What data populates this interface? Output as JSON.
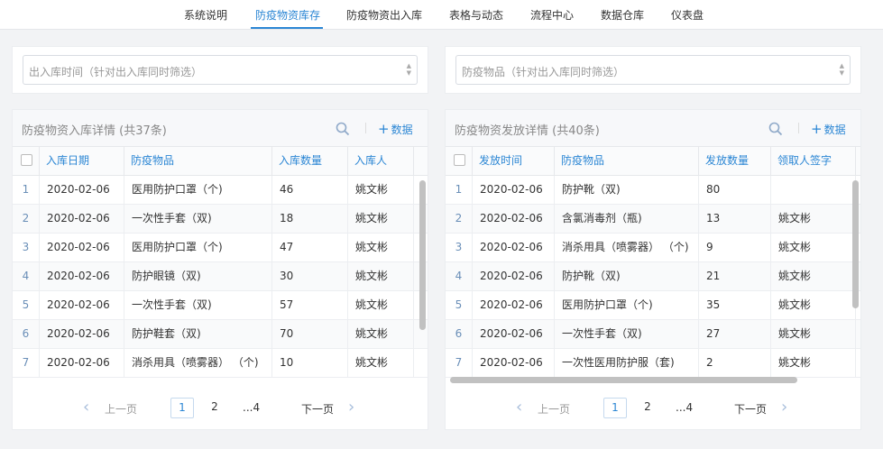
{
  "nav": {
    "items": [
      "系统说明",
      "防疫物资库存",
      "防疫物资出入库",
      "表格与动态",
      "流程中心",
      "数据仓库",
      "仪表盘"
    ],
    "active_index": 1
  },
  "filters": {
    "left_placeholder": "出入库时间（针对出入库同时筛选）",
    "right_placeholder": "防疫物品（针对出入库同时筛选）"
  },
  "left_panel": {
    "title": "防疫物资入库详情 (共37条)",
    "add_label": "数据",
    "columns": [
      "入库日期",
      "防疫物品",
      "入库数量",
      "入库人"
    ],
    "rows": [
      {
        "no": "1",
        "date": "2020-02-06",
        "item": "医用防护口罩（个)",
        "qty": "46",
        "person": "姚文彬"
      },
      {
        "no": "2",
        "date": "2020-02-06",
        "item": "一次性手套（双)",
        "qty": "18",
        "person": "姚文彬"
      },
      {
        "no": "3",
        "date": "2020-02-06",
        "item": "医用防护口罩（个)",
        "qty": "47",
        "person": "姚文彬"
      },
      {
        "no": "4",
        "date": "2020-02-06",
        "item": "防护眼镜（双)",
        "qty": "30",
        "person": "姚文彬"
      },
      {
        "no": "5",
        "date": "2020-02-06",
        "item": "一次性手套（双)",
        "qty": "57",
        "person": "姚文彬"
      },
      {
        "no": "6",
        "date": "2020-02-06",
        "item": "防护鞋套（双)",
        "qty": "70",
        "person": "姚文彬"
      },
      {
        "no": "7",
        "date": "2020-02-06",
        "item": "消杀用具（喷雾器） （个)",
        "qty": "10",
        "person": "姚文彬"
      }
    ],
    "pager": {
      "prev": "上一页",
      "next": "下一页",
      "pages": [
        "1",
        "2"
      ],
      "last": "...4"
    }
  },
  "right_panel": {
    "title": "防疫物资发放详情 (共40条)",
    "add_label": "数据",
    "columns": [
      "发放时间",
      "防疫物品",
      "发放数量",
      "领取人签字"
    ],
    "rows": [
      {
        "no": "1",
        "date": "2020-02-06",
        "item": "防护靴（双)",
        "qty": "80",
        "person": ""
      },
      {
        "no": "2",
        "date": "2020-02-06",
        "item": "含氯消毒剂（瓶)",
        "qty": "13",
        "person": "姚文彬"
      },
      {
        "no": "3",
        "date": "2020-02-06",
        "item": "消杀用具（喷雾器） （个)",
        "qty": "9",
        "person": "姚文彬"
      },
      {
        "no": "4",
        "date": "2020-02-06",
        "item": "防护靴（双)",
        "qty": "21",
        "person": "姚文彬"
      },
      {
        "no": "5",
        "date": "2020-02-06",
        "item": "医用防护口罩（个)",
        "qty": "35",
        "person": "姚文彬"
      },
      {
        "no": "6",
        "date": "2020-02-06",
        "item": "一次性手套（双)",
        "qty": "27",
        "person": "姚文彬"
      },
      {
        "no": "7",
        "date": "2020-02-06",
        "item": "一次性医用防护服（套)",
        "qty": "2",
        "person": "姚文彬"
      }
    ],
    "pager": {
      "prev": "上一页",
      "next": "下一页",
      "pages": [
        "1",
        "2"
      ],
      "last": "...4"
    }
  },
  "colors": {
    "accent": "#2b86d4",
    "index_text": "#6a8fb8"
  },
  "icons": {
    "search": "search-icon",
    "add": "plus-icon",
    "prev": "chevron-left-icon",
    "next": "chevron-right-icon"
  }
}
